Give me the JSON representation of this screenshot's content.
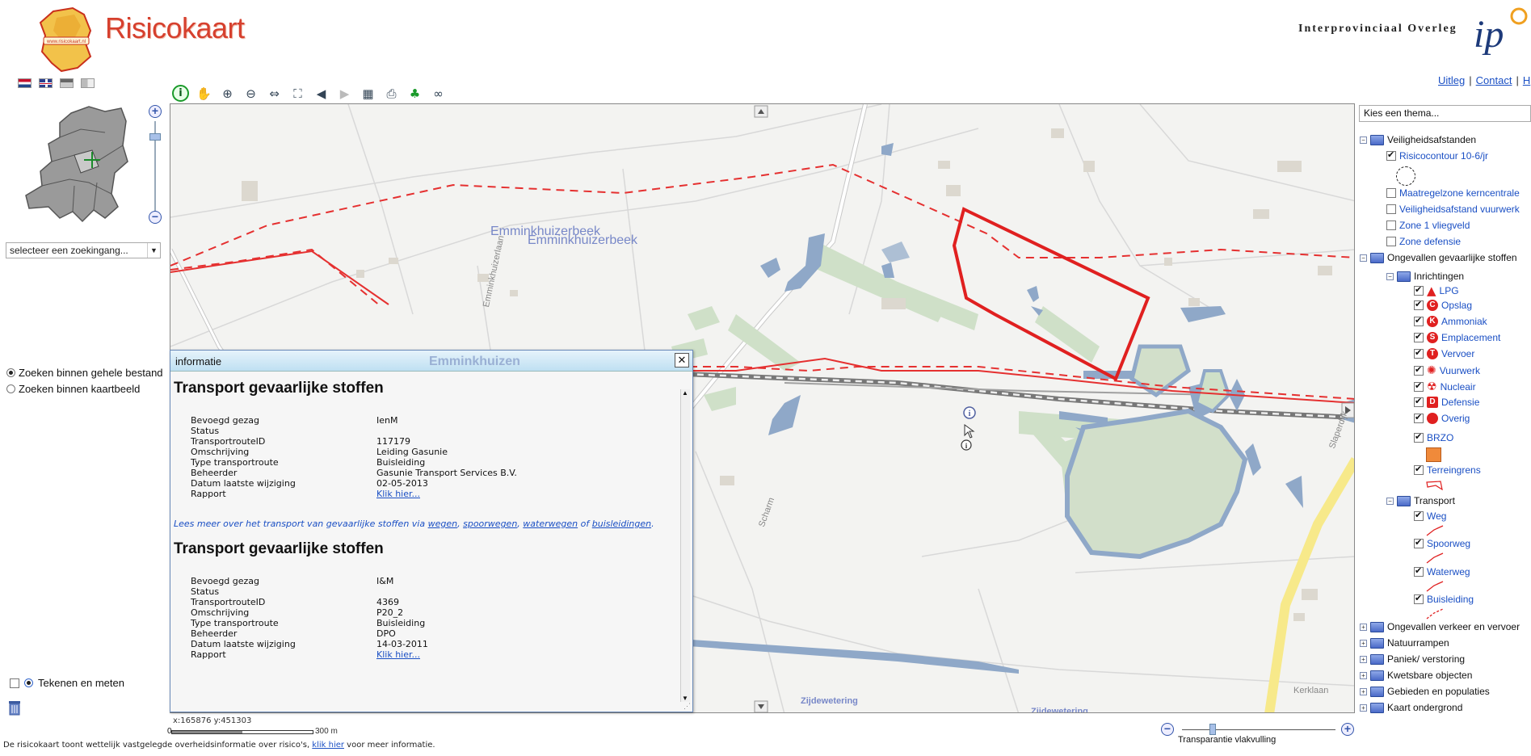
{
  "header": {
    "title": "Risicokaart",
    "logo_text": "www.risicokaart.nl",
    "org_name": "Interprovinciaal Overleg",
    "org_logo": "ip"
  },
  "toplinks": [
    {
      "label": "Uitleg"
    },
    {
      "label": "Contact"
    },
    {
      "label": "H"
    }
  ],
  "search": {
    "select_label": "selecteer  een zoekingang...",
    "radio_all": "Zoeken binnen gehele bestand",
    "radio_map": "Zoeken binnen kaartbeeld"
  },
  "draw": {
    "label": "Tekenen en meten"
  },
  "map": {
    "labels": {
      "beek1": "Emminkhuizerbeek",
      "beek2": "Emminkhuizerbeek",
      "place": "Emminkhuizen",
      "street1": "Emminkhuizerlaan",
      "street2": "Scharm",
      "street3": "Slaperdijk",
      "wetering1": "Zijdewetering",
      "wetering2": "Zijdewetering",
      "kerklaan": "Kerklaan"
    }
  },
  "info": {
    "title": "informatie",
    "sections": [
      {
        "heading": "Transport gevaarlijke stoffen",
        "rows": [
          {
            "k": "Bevoegd gezag",
            "v": "IenM"
          },
          {
            "k": "Status",
            "v": ""
          },
          {
            "k": "TransportrouteID",
            "v": "117179"
          },
          {
            "k": "Omschrijving",
            "v": "Leiding Gasunie"
          },
          {
            "k": "Type transportroute",
            "v": "Buisleiding"
          },
          {
            "k": "Beheerder",
            "v": "Gasunie Transport Services B.V."
          },
          {
            "k": "Datum laatste wijziging",
            "v": "02-05-2013"
          },
          {
            "k": "Rapport",
            "v": "Klik hier..."
          }
        ]
      },
      {
        "heading": "Transport gevaarlijke stoffen",
        "rows": [
          {
            "k": "Bevoegd gezag",
            "v": "I&M"
          },
          {
            "k": "Status",
            "v": ""
          },
          {
            "k": "TransportrouteID",
            "v": "4369"
          },
          {
            "k": "Omschrijving",
            "v": "P20_2"
          },
          {
            "k": "Type transportroute",
            "v": "Buisleiding"
          },
          {
            "k": "Beheerder",
            "v": "DPO"
          },
          {
            "k": "Datum laatste wijziging",
            "v": "14-03-2011"
          },
          {
            "k": "Rapport",
            "v": "Klik hier..."
          }
        ]
      }
    ],
    "more": {
      "prefix": "Lees meer over het transport van gevaarlijke stoffen via ",
      "l1": "wegen",
      "l2": "spoorwegen",
      "l3": "waterwegen",
      "mid": " of ",
      "l4": "buisleidingen",
      "end": "."
    }
  },
  "status": {
    "coords": "x:165876 y:451303",
    "scale_zero": "0",
    "scale_label": "300 m",
    "transparency_label": "Transparantie vlakvulling"
  },
  "footer": {
    "prefix": "De risicokaart toont wettelijk vastgelegde overheidsinformatie over risico's, ",
    "link": "klik hier",
    "suffix": " voor meer informatie."
  },
  "themes": {
    "select_label": "Kies een thema...",
    "items": {
      "veilig": "Veiligheidsafstanden",
      "risicocontour": "Risicocontour 10-6/jr",
      "maatregelzone": "Maatregelzone kerncentrale",
      "vuurwerk_afstand": "Veiligheidsafstand vuurwerk",
      "zone1": "Zone 1 vliegveld",
      "zonedef": "Zone defensie",
      "ongevallen": "Ongevallen gevaarlijke stoffen",
      "inrichtingen": "Inrichtingen",
      "lpg": "LPG",
      "opslag": "Opslag",
      "ammoniak": "Ammoniak",
      "emplacement": "Emplacement",
      "vervoer": "Vervoer",
      "vuurwerk": "Vuurwerk",
      "nucleair": "Nucleair",
      "defensie": "Defensie",
      "overig": "Overig",
      "brzo": "BRZO",
      "terreingrens": "Terreingrens",
      "transport": "Transport",
      "weg": "Weg",
      "spoorweg": "Spoorweg",
      "waterweg": "Waterweg",
      "buisleiding": "Buisleiding",
      "verkeer": "Ongevallen verkeer en vervoer",
      "natuur": "Natuurrampen",
      "paniek": "Paniek/ verstoring",
      "kwetsbaar": "Kwetsbare objecten",
      "gebieden": "Gebieden en populaties",
      "ondergrond": "Kaart ondergrond"
    },
    "symbols": {
      "opslag": "C",
      "ammoniak": "K",
      "emplacement": "S",
      "vervoer": "T",
      "defensie": "D"
    }
  },
  "colors": {
    "accent_red": "#e02020",
    "link_blue": "#1a4fc4",
    "water": "#8fa8c8"
  }
}
